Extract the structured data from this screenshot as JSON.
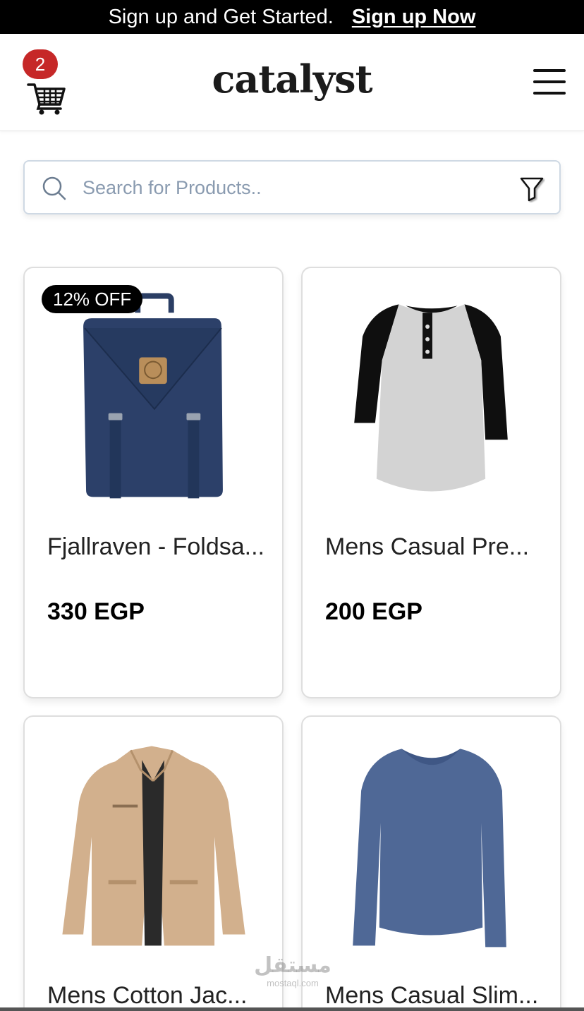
{
  "promo": {
    "text": "Sign up and Get Started.",
    "link_label": "Sign up Now"
  },
  "header": {
    "brand": "catalyst",
    "cart_count": "2",
    "cart_icon": "cart-icon",
    "menu_icon": "hamburger-menu-icon"
  },
  "search": {
    "placeholder": "Search for Products..",
    "value": "",
    "search_icon": "search-icon",
    "filter_icon": "filter-icon"
  },
  "products": [
    {
      "title": "Fjallraven - Foldsa...",
      "price": "330 EGP",
      "badge": "12% OFF",
      "image": "navy-backpack"
    },
    {
      "title": "Mens Casual Pre...",
      "price": "200 EGP",
      "badge": "",
      "image": "raglan-henley-tshirt"
    },
    {
      "title": "Mens Cotton Jac...",
      "price": "",
      "badge": "",
      "image": "beige-cotton-jacket"
    },
    {
      "title": "Mens Casual Slim...",
      "price": "",
      "badge": "",
      "image": "blue-long-sleeve-tshirt"
    }
  ],
  "watermark": {
    "arabic": "مستقل",
    "latin": "mostaql.com"
  },
  "colors": {
    "badge_red": "#c62828",
    "promo_black": "#000000",
    "search_border": "#cfd9e4",
    "placeholder": "#8a9bb0"
  }
}
